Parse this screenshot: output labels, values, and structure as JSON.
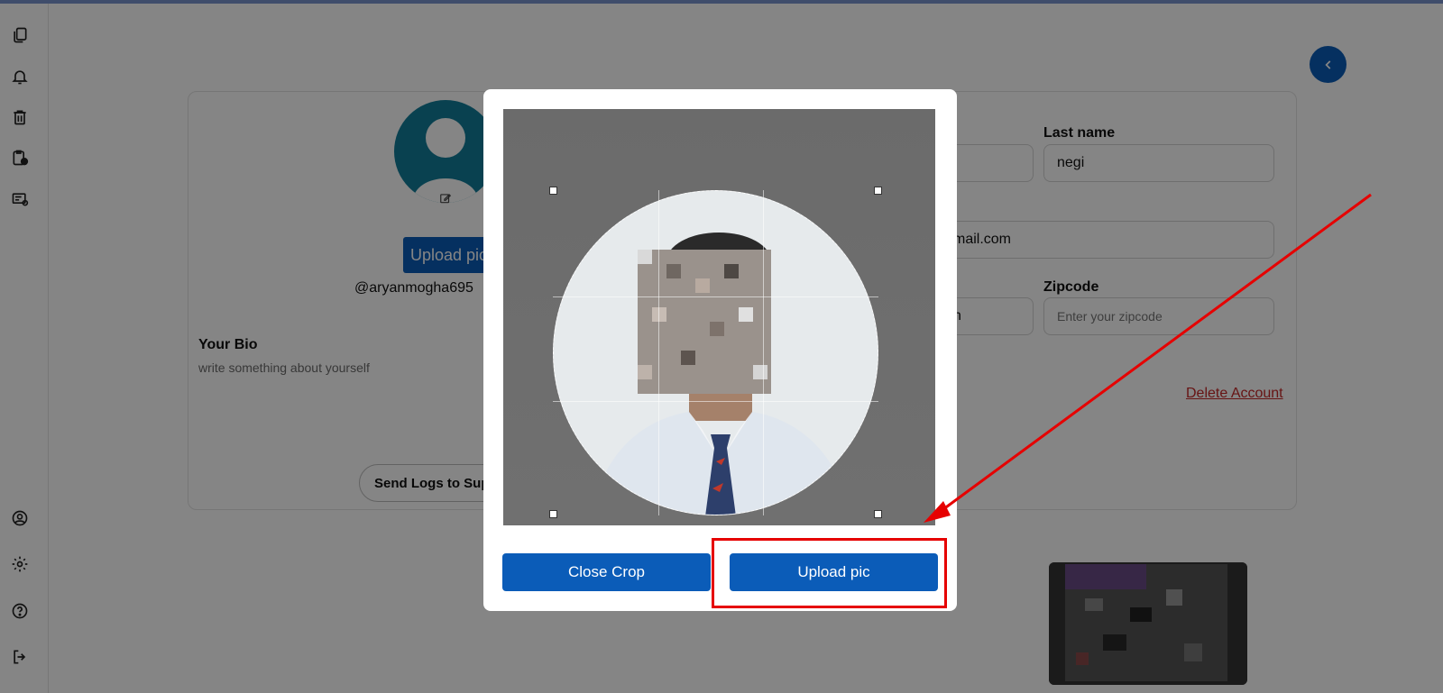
{
  "profile": {
    "upload_button_label": "Upload pic",
    "username": "@aryanmogha695",
    "bio_title": "Your Bio",
    "bio_placeholder": "write something about yourself",
    "send_logs_label": "Send Logs to Support"
  },
  "form": {
    "last_name_label": "Last name",
    "last_name_value": "negi",
    "email_value_partial": "mail.com",
    "zipcode_label": "Zipcode",
    "zipcode_placeholder": "Enter your zipcode",
    "city_value_partial": "n",
    "delete_account_label": "Delete Account"
  },
  "sidebar": {
    "top_icons": [
      "pages-icon",
      "bell-icon",
      "trash-icon",
      "clipboard-clock-icon",
      "receipt-icon"
    ],
    "bottom_icons": [
      "user-circle-icon",
      "gear-icon",
      "help-icon",
      "logout-icon"
    ]
  },
  "modal": {
    "close_crop_label": "Close Crop",
    "upload_pic_label": "Upload pic"
  },
  "colors": {
    "primary": "#0b5cb8",
    "avatar": "#127e9a",
    "danger": "#c62828",
    "annotation": "#e60000"
  }
}
